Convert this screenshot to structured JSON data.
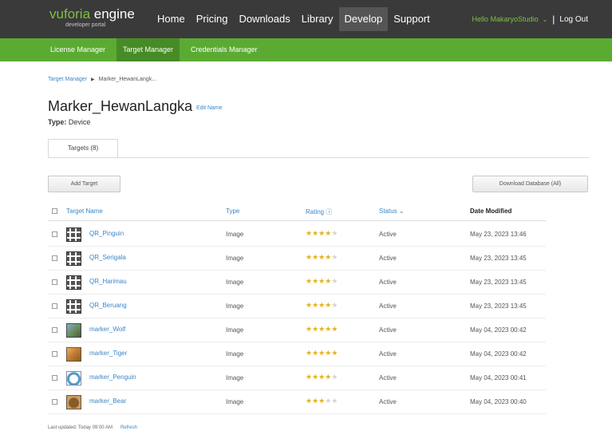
{
  "logo": {
    "part1": "vuforia",
    "part2": " engine",
    "sub": "developer portal"
  },
  "nav": {
    "items": [
      {
        "label": "Home",
        "active": false
      },
      {
        "label": "Pricing",
        "active": false
      },
      {
        "label": "Downloads",
        "active": false
      },
      {
        "label": "Library",
        "active": false
      },
      {
        "label": "Develop",
        "active": true
      },
      {
        "label": "Support",
        "active": false
      }
    ],
    "hello": "Hello MakaryoStudio",
    "logout": "Log Out"
  },
  "subnav": {
    "items": [
      {
        "label": "License Manager",
        "active": false
      },
      {
        "label": "Target Manager",
        "active": true
      },
      {
        "label": "Credentials Manager",
        "active": false
      }
    ]
  },
  "breadcrumb": {
    "root": "Target Manager",
    "current": "Marker_HewanLangk..."
  },
  "page": {
    "title": "Marker_HewanLangka",
    "edit_name": "Edit Name",
    "type_label": "Type:",
    "type_value": "Device",
    "tab": "Targets (8)",
    "add_target": "Add Target",
    "download_db": "Download Database (All)"
  },
  "table": {
    "headers": {
      "name": "Target Name",
      "type": "Type",
      "rating": "Rating ⓘ",
      "status": "Status ⌄",
      "date": "Date Modified"
    },
    "rows": [
      {
        "name": "QR_Pinguin",
        "thumb": "qr",
        "type": "Image",
        "rating": 4,
        "status": "Active",
        "date": "May 23, 2023 13:46"
      },
      {
        "name": "QR_Serigala",
        "thumb": "qr",
        "type": "Image",
        "rating": 4,
        "status": "Active",
        "date": "May 23, 2023 13:45"
      },
      {
        "name": "QR_Harimau",
        "thumb": "qr",
        "type": "Image",
        "rating": 4,
        "status": "Active",
        "date": "May 23, 2023 13:45"
      },
      {
        "name": "QR_Beruang",
        "thumb": "qr",
        "type": "Image",
        "rating": 4,
        "status": "Active",
        "date": "May 23, 2023 13:45"
      },
      {
        "name": "marker_Wolf",
        "thumb": "img-wolf",
        "type": "Image",
        "rating": 5,
        "status": "Active",
        "date": "May 04, 2023 00:42"
      },
      {
        "name": "marker_Tiger",
        "thumb": "img-tiger",
        "type": "Image",
        "rating": 5,
        "status": "Active",
        "date": "May 04, 2023 00:42"
      },
      {
        "name": "marker_Penguin",
        "thumb": "img-penguin",
        "type": "Image",
        "rating": 4,
        "status": "Active",
        "date": "May 04, 2023 00:41"
      },
      {
        "name": "marker_Bear",
        "thumb": "img-bear",
        "type": "Image",
        "rating": 3,
        "status": "Active",
        "date": "May 04, 2023 00:40"
      }
    ]
  },
  "footer": {
    "last_updated": "Last updated: Today 09:00 AM",
    "refresh": "Refresh"
  },
  "colors": {
    "topbar": "#3a3a3a",
    "subbar": "#5bab33",
    "link": "#3a86c8",
    "star": "#e6b020"
  }
}
